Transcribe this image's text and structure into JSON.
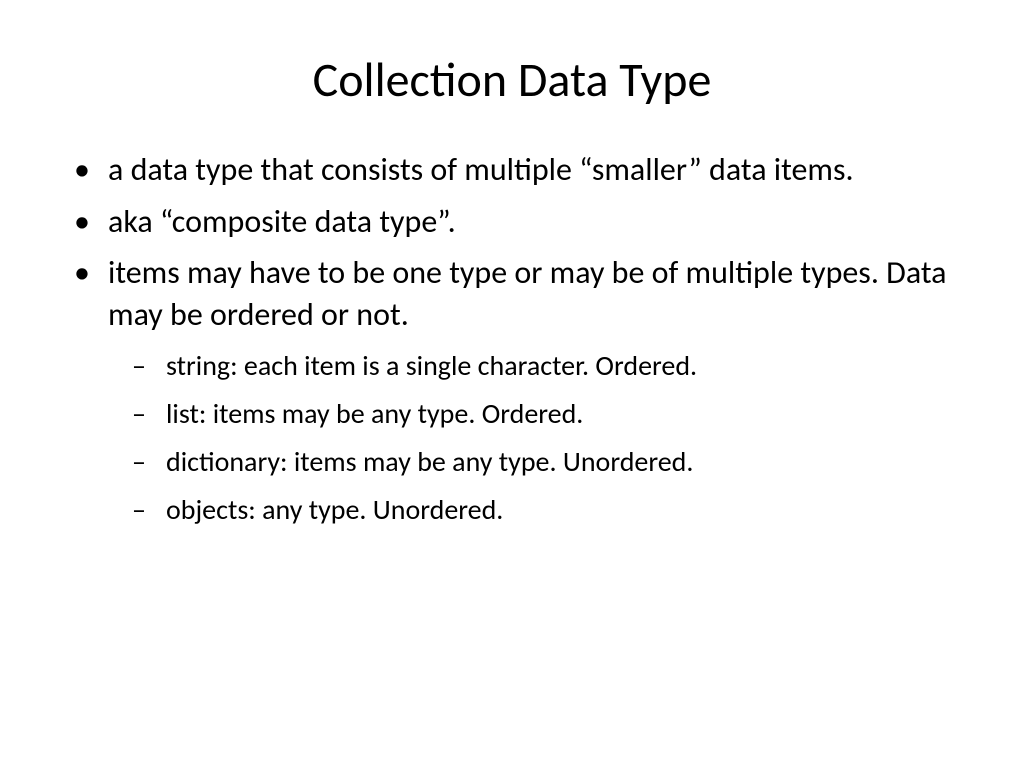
{
  "title": "Collection Data Type",
  "bullets": {
    "b0": "a data type that consists of multiple “smaller” data items.",
    "b1": "aka “composite data type”.",
    "b2": "items may have to be one type or may be of multiple types. Data may be ordered or not.",
    "sub": {
      "s0": "string: each item is a single character.  Ordered.",
      "s1": "list: items may be any type.  Ordered.",
      "s2": "dictionary: items may be any type.  Unordered.",
      "s3": "objects: any type.  Unordered."
    }
  }
}
